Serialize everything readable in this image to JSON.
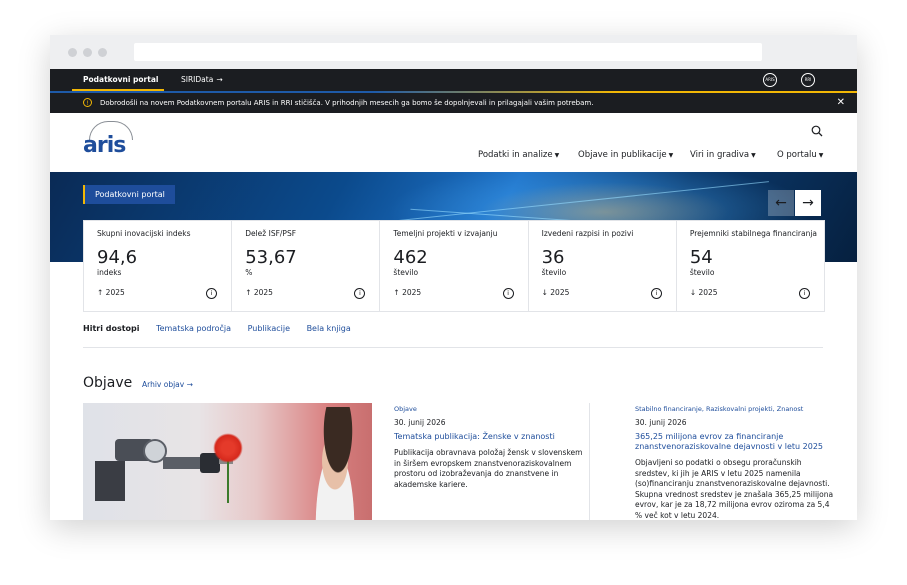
{
  "topnav": {
    "active": "Podatkovni portal",
    "siri": "SIRIData",
    "siri_arrow": "→",
    "logo1": "ARIS",
    "logo2": "RRI"
  },
  "notice": {
    "icon": "!",
    "message": "Dobrodošli na novem Podatkovnem portalu ARIS in RRI stičišča. V prihodnjih mesecih ga bomo še dopolnjevali in prilagajali vašim potrebam.",
    "close": "✕"
  },
  "header": {
    "logo_text": "aris",
    "search_icon": "search-icon",
    "nav": [
      {
        "label": "Podatki in analize"
      },
      {
        "label": "Objave in publikacije"
      },
      {
        "label": "Viri in gradiva"
      },
      {
        "label": "O portalu"
      }
    ]
  },
  "hero": {
    "tab_label": "Podatkovni portal",
    "prev": "←",
    "next": "→"
  },
  "stats": [
    {
      "label": "Skupni inovacijski indeks",
      "value": "94,6",
      "unit": "indeks",
      "year": "↑ 2025"
    },
    {
      "label": "Delež ISF/PSF",
      "value": "53,67",
      "unit": "%",
      "year": "↑ 2025"
    },
    {
      "label": "Temeljni projekti v izvajanju",
      "value": "462",
      "unit": "število",
      "year": "↑ 2025"
    },
    {
      "label": "Izvedeni razpisi in pozivi",
      "value": "36",
      "unit": "število",
      "year": "↓ 2025"
    },
    {
      "label": "Prejemniki stabilnega financiranja",
      "value": "54",
      "unit": "število",
      "year": "↓ 2025"
    }
  ],
  "quick": {
    "label": "Hitri dostopi",
    "links": [
      "Tematska področja",
      "Publikacije",
      "Bela knjiga"
    ]
  },
  "objave": {
    "title": "Objave",
    "archive": "Arhiv objav →",
    "news": [
      {
        "category": "Objave",
        "date": "30. junij 2026",
        "title": "Tematska publikacija: Ženske v znanosti",
        "desc": "Publikacija obravnava položaj žensk v slovenskem in širšem evropskem znanstvenoraziskovalnem prostoru od izobraževanja do znanstvene in akademske kariere."
      },
      {
        "category": "Stabilno financiranje, Raziskovalni projekti, Znanost",
        "date": "30. junij 2026",
        "title": "365,25 milijona evrov za financiranje znanstvenoraziskovalne dejavnosti v letu 2025",
        "desc": "Objavljeni so podatki o obsegu proračunskih sredstev, ki jih je ARIS v letu 2025 namenila (so)financiranju znanstvenoraziskovalne dejavnosti. Skupna vrednost sredstev je znašala 365,25 milijona evrov, kar je za 18,72 milijona evrov oziroma za 5,4 % več kot v letu 2024."
      }
    ]
  }
}
